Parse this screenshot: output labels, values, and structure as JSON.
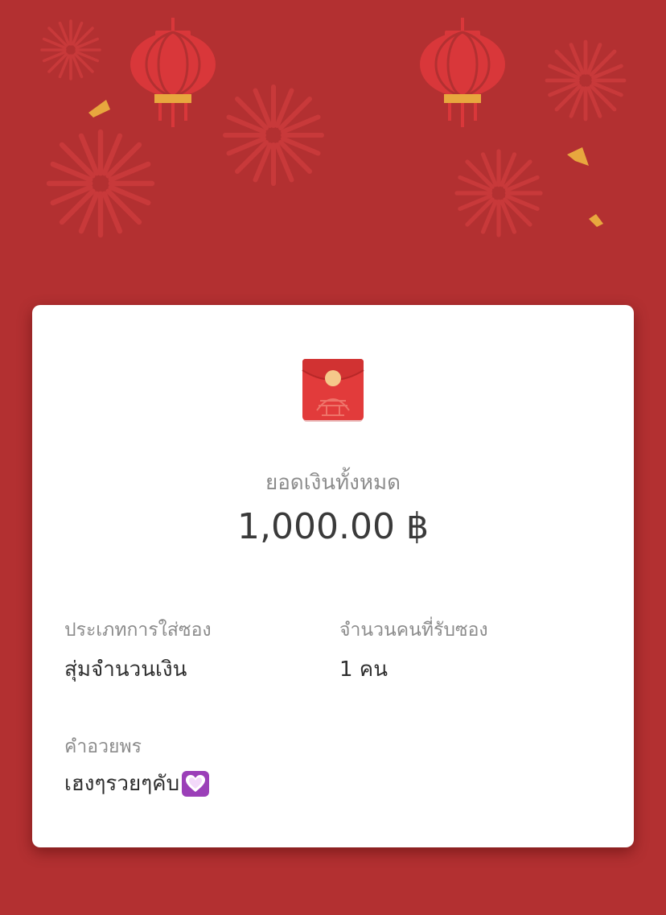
{
  "summary": {
    "total_label": "ยอดเงินทั้งหมด",
    "total_amount": "1,000.00 ฿"
  },
  "details": {
    "type_label": "ประเภทการใส่ซอง",
    "type_value": "สุ่มจำนวนเงิน",
    "recipients_label": "จำนวนคนที่รับซอง",
    "recipients_value": "1 คน"
  },
  "blessing": {
    "label": "คำอวยพร",
    "text": "เฮงๆรวยๆคับ",
    "emoji_icon": "purple-heart-icon"
  },
  "icons": {
    "envelope": "red-envelope-icon",
    "lanterns": "lantern-icon",
    "fireworks": "firework-icon"
  },
  "colors": {
    "background": "#B33031",
    "decor_red": "#D9373A",
    "lantern_band": "#E8A73E",
    "envelope_red": "#E23B3B",
    "envelope_button": "#F5C98A",
    "heart_badge": "#9B3FB8"
  }
}
